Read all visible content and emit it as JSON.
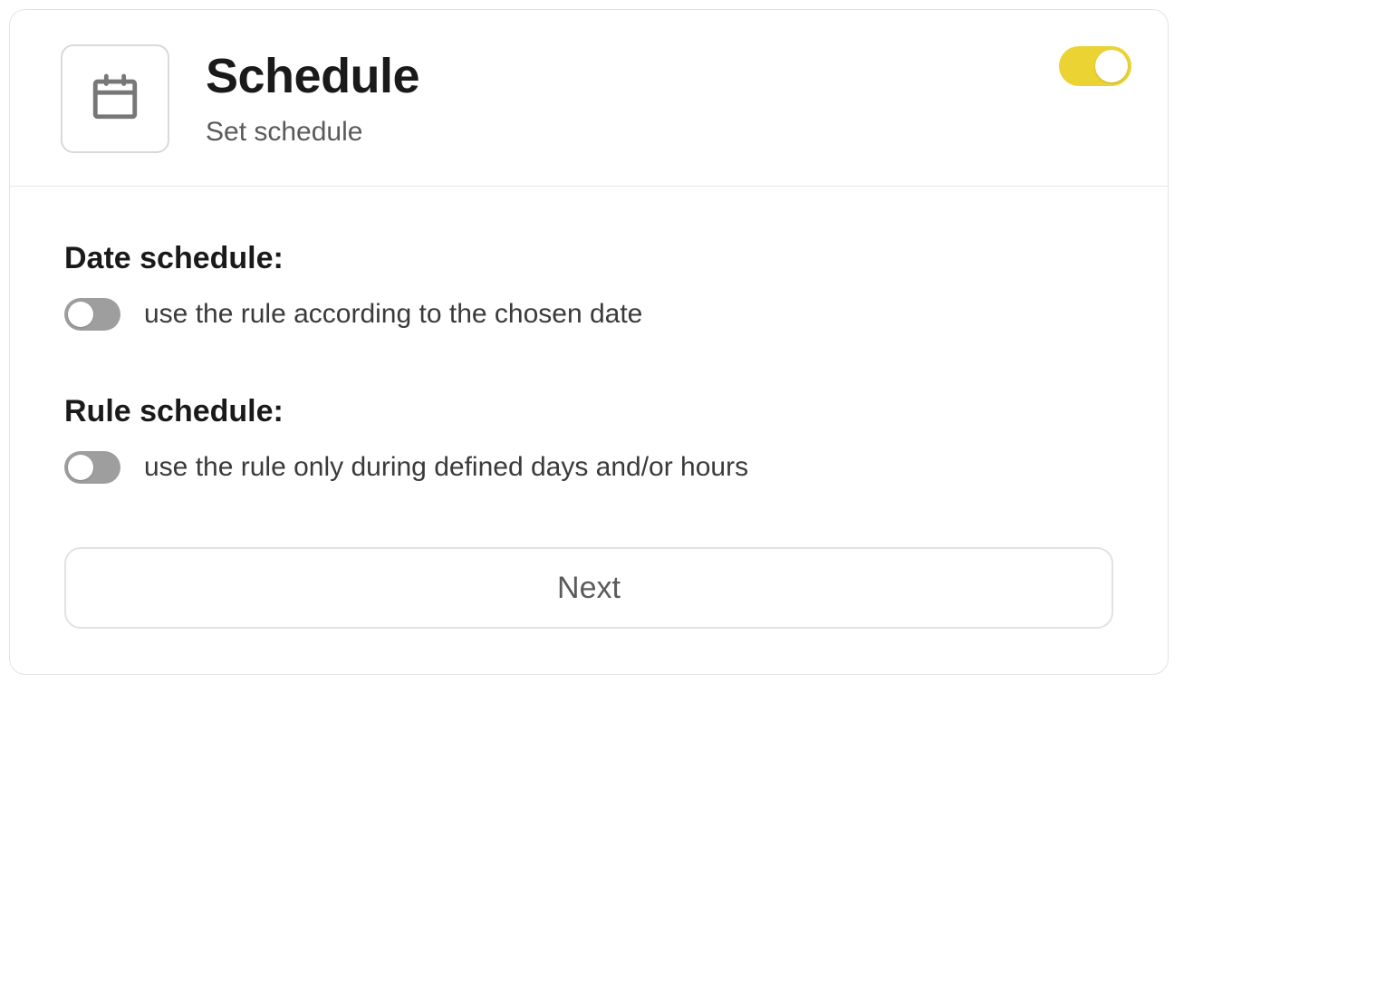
{
  "header": {
    "title": "Schedule",
    "subtitle": "Set schedule",
    "icon": "calendar-icon",
    "enabled": true
  },
  "sections": {
    "date": {
      "title": "Date schedule:",
      "option_label": "use the rule according to the chosen date",
      "enabled": false
    },
    "rule": {
      "title": "Rule schedule:",
      "option_label": "use the rule only during defined days and/or hours",
      "enabled": false
    }
  },
  "actions": {
    "next_label": "Next"
  },
  "colors": {
    "accent": "#ebd334",
    "toggle_off": "#9e9e9e"
  }
}
